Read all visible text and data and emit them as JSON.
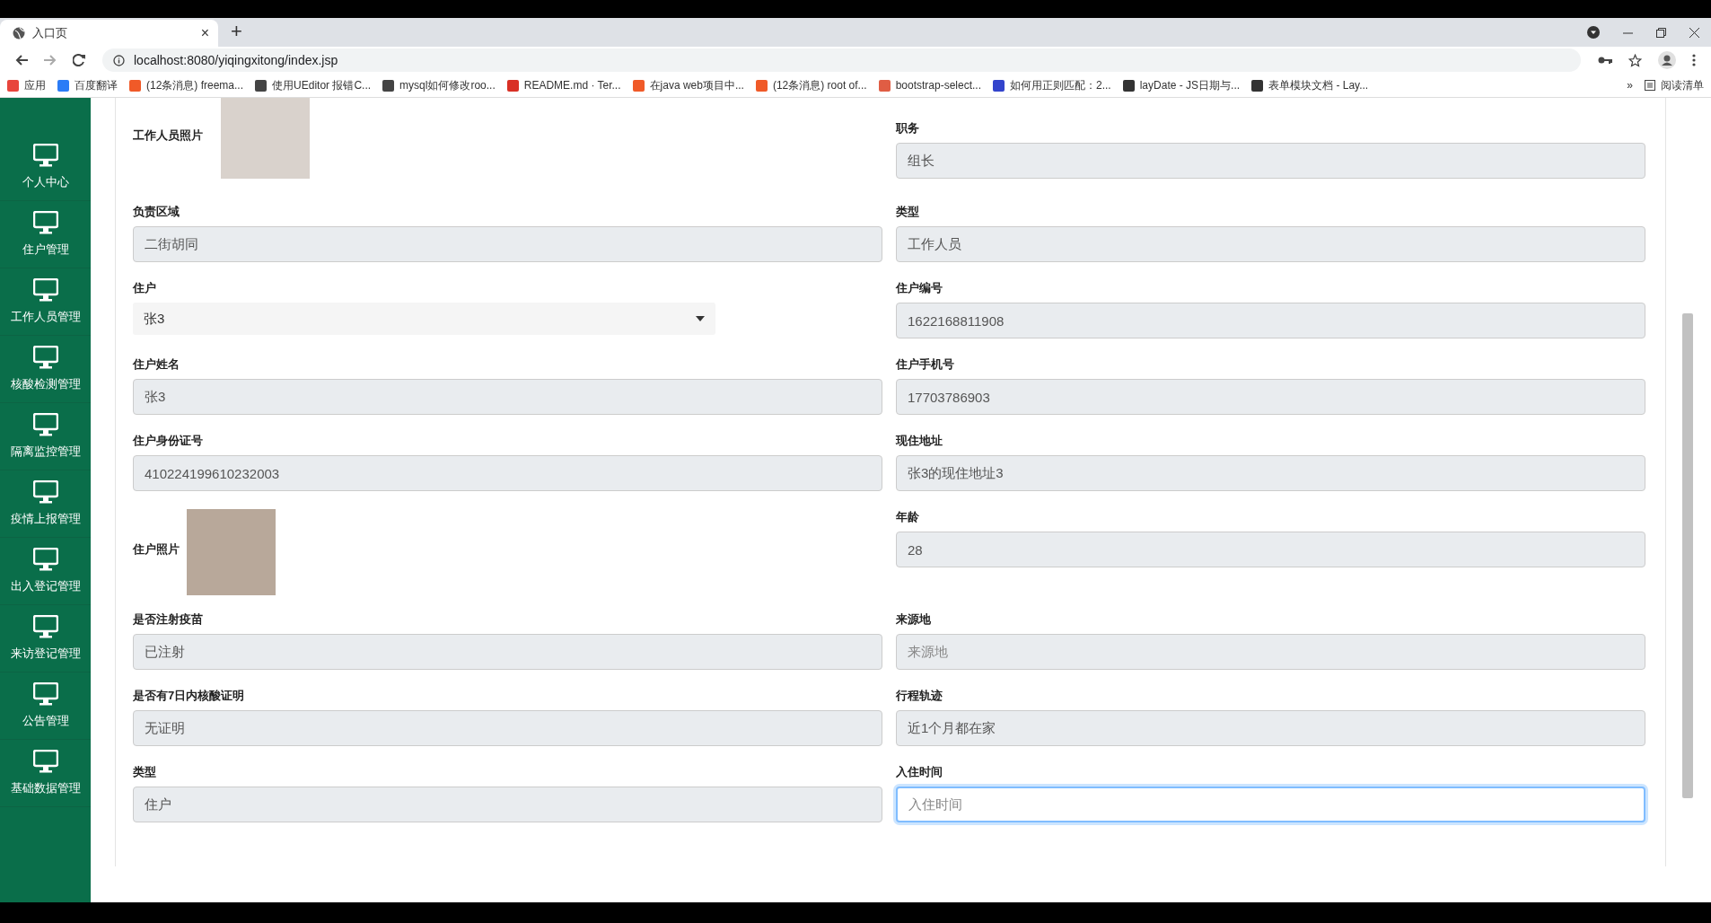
{
  "browser": {
    "tab": {
      "title": "入口页",
      "close": "×"
    },
    "new_tab": "+",
    "url": "localhost:8080/yiqingxitong/index.jsp",
    "bookmarks": [
      {
        "label": "应用",
        "color": "#e8453c"
      },
      {
        "label": "百度翻译",
        "color": "#2b7cf6"
      },
      {
        "label": "(12条消息) freema...",
        "color": "#f05a28"
      },
      {
        "label": "使用UEditor 报错C...",
        "color": "#444444"
      },
      {
        "label": "mysql如何修改roo...",
        "color": "#444444"
      },
      {
        "label": "README.md · Ter...",
        "color": "#d93025"
      },
      {
        "label": "在java web项目中...",
        "color": "#f05a28"
      },
      {
        "label": "(12条消息) root of...",
        "color": "#f05a28"
      },
      {
        "label": "bootstrap-select...",
        "color": "#e05d44"
      },
      {
        "label": "如何用正则匹配：2...",
        "color": "#3344cc"
      },
      {
        "label": "layDate - JS日期与...",
        "color": "#333333"
      },
      {
        "label": "表单模块文档 - Lay...",
        "color": "#333333"
      }
    ],
    "more": "»",
    "reading_list": "阅读清单"
  },
  "sidebar": {
    "items": [
      {
        "label": "个人中心"
      },
      {
        "label": "住户管理"
      },
      {
        "label": "工作人员管理"
      },
      {
        "label": "核酸检测管理"
      },
      {
        "label": "隔离监控管理"
      },
      {
        "label": "疫情上报管理"
      },
      {
        "label": "出入登记管理"
      },
      {
        "label": "来访登记管理"
      },
      {
        "label": "公告管理"
      },
      {
        "label": "基础数据管理"
      }
    ]
  },
  "form": {
    "rows": [
      [
        {
          "kind": "photo",
          "label": "工作人员照片"
        },
        {
          "kind": "input",
          "label": "职务",
          "value": "组长",
          "disabled": true,
          "focused": false
        }
      ],
      [
        {
          "kind": "input",
          "label": "负责区域",
          "value": "二街胡同",
          "disabled": true,
          "focused": false
        },
        {
          "kind": "input",
          "label": "类型",
          "value": "工作人员",
          "disabled": true,
          "focused": false
        }
      ],
      [
        {
          "kind": "select",
          "label": "住户",
          "value": "张3"
        },
        {
          "kind": "input",
          "label": "住户编号",
          "value": "1622168811908",
          "disabled": true,
          "focused": false
        }
      ],
      [
        {
          "kind": "input",
          "label": "住户姓名",
          "value": "张3",
          "disabled": true,
          "focused": false
        },
        {
          "kind": "input",
          "label": "住户手机号",
          "value": "17703786903",
          "disabled": true,
          "focused": false
        }
      ],
      [
        {
          "kind": "input",
          "label": "住户身份证号",
          "value": "410224199610232003",
          "disabled": true,
          "focused": false
        },
        {
          "kind": "input",
          "label": "现住地址",
          "value": "张3的现住地址3",
          "disabled": true,
          "focused": false
        }
      ],
      [
        {
          "kind": "photo",
          "label": "住户照片"
        },
        {
          "kind": "input",
          "label": "年龄",
          "value": "28",
          "disabled": true,
          "focused": false
        }
      ],
      [
        {
          "kind": "input",
          "label": "是否注射疫苗",
          "value": "已注射",
          "disabled": true,
          "focused": false
        },
        {
          "kind": "input",
          "label": "来源地",
          "placeholder": "来源地",
          "disabled": true,
          "focused": false
        }
      ],
      [
        {
          "kind": "input",
          "label": "是否有7日内核酸证明",
          "value": "无证明",
          "disabled": true,
          "focused": false
        },
        {
          "kind": "input",
          "label": "行程轨迹",
          "value": "近1个月都在家",
          "disabled": true,
          "focused": false
        }
      ],
      [
        {
          "kind": "input",
          "label": "类型",
          "value": "住户",
          "disabled": true,
          "focused": false
        },
        {
          "kind": "input",
          "label": "入住时间",
          "placeholder": "入住时间",
          "disabled": false,
          "focused": true
        }
      ]
    ]
  }
}
